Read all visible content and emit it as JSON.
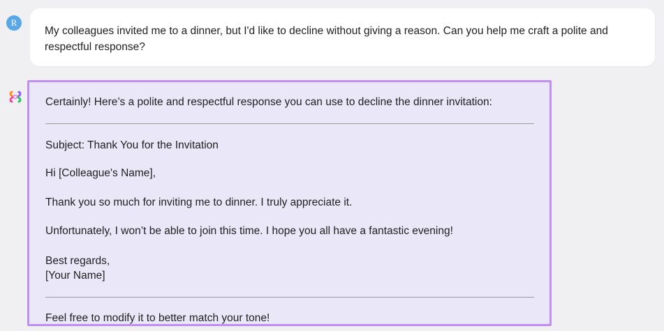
{
  "user_message": {
    "avatar_initial": "R",
    "text": "My colleagues invited me to a dinner, but I'd like to decline without giving a reason. Can you help me craft a polite and respectful response?"
  },
  "assistant_message": {
    "logo_icon": "multicolor-knot-icon",
    "intro": "Certainly! Here’s a polite and respectful response you can use to decline the dinner invitation:",
    "subject": "Subject: Thank You for the Invitation",
    "greeting": "Hi [Colleague's Name],",
    "body": [
      "Thank you so much for inviting me to dinner. I truly appreciate it.",
      "Unfortunately, I won’t be able to join this time. I hope you all have a fantastic evening!"
    ],
    "signoff": "Best regards,",
    "signature": "[Your Name]",
    "footer": "Feel free to modify it to better match your tone!"
  },
  "colors": {
    "page_background": "#f0f0f2",
    "user_bubble": "#ffffff",
    "avatar": "#5aa7e8",
    "assistant_bubble": "#e9e7f8",
    "highlight_border": "#c08ef7"
  }
}
